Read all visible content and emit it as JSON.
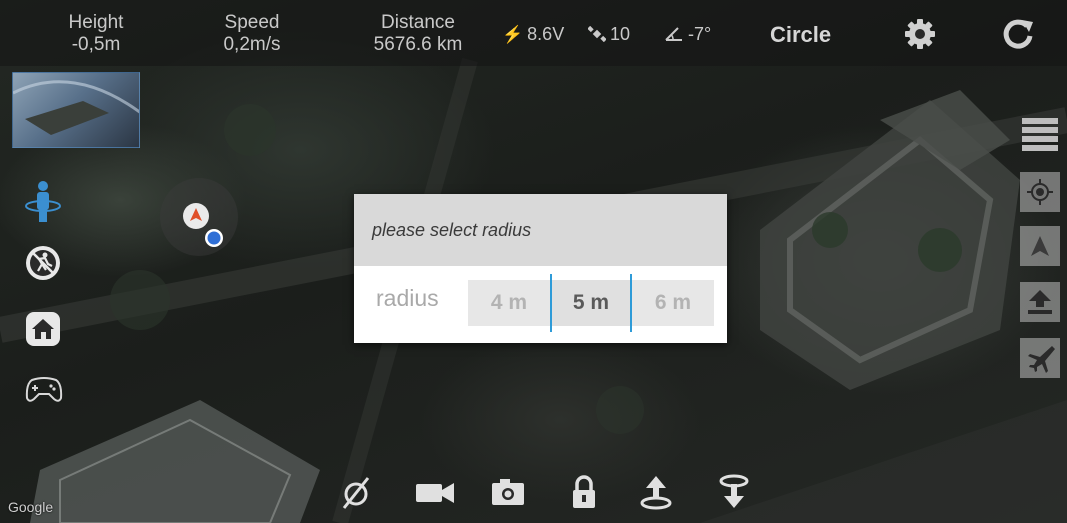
{
  "status_bar": {
    "height": {
      "label": "Height",
      "value": "-0,5m"
    },
    "speed": {
      "label": "Speed",
      "value": "0,2m/s"
    },
    "distance": {
      "label": "Distance",
      "value": "5676.6 km"
    },
    "voltage": {
      "icon": "lightning-icon",
      "value": "8.6V"
    },
    "satellites": {
      "icon": "satellite-icon",
      "value": "10"
    },
    "tilt": {
      "icon": "angle-icon",
      "value": "-7°"
    },
    "flight_mode": "Circle",
    "settings_icon": "gear-icon",
    "refresh_icon": "refresh-icon"
  },
  "map": {
    "attribution": "Google"
  },
  "left_toolbar": [
    {
      "name": "follow-me-mode",
      "icon": "person-orbit-icon"
    },
    {
      "name": "no-fly",
      "icon": "no-runner-icon"
    },
    {
      "name": "home",
      "icon": "home-icon"
    },
    {
      "name": "gamepad",
      "icon": "gamepad-icon"
    }
  ],
  "right_toolbar": [
    {
      "name": "menu",
      "icon": "list-icon"
    },
    {
      "name": "locate",
      "icon": "crosshair-icon"
    },
    {
      "name": "navigate",
      "icon": "navigation-arrow-icon"
    },
    {
      "name": "upload",
      "icon": "upload-icon"
    },
    {
      "name": "flight",
      "icon": "airplane-icon"
    }
  ],
  "bottom_toolbar": [
    {
      "name": "gimbal",
      "icon": "gimbal-slash-icon"
    },
    {
      "name": "video",
      "icon": "video-camera-icon"
    },
    {
      "name": "photo",
      "icon": "camera-icon"
    },
    {
      "name": "lock",
      "icon": "lock-icon"
    },
    {
      "name": "takeoff",
      "icon": "takeoff-icon"
    },
    {
      "name": "land",
      "icon": "land-icon"
    }
  ],
  "dialog": {
    "title": "please select radius",
    "field_label": "radius",
    "options": [
      "4 m",
      "5 m",
      "6 m"
    ],
    "selected": "5 m"
  },
  "colors": {
    "accent": "#2e9bd8",
    "drone_marker": "#e0502a",
    "location_dot": "#2f6fd6",
    "follow_icon": "#3b8fd0"
  }
}
